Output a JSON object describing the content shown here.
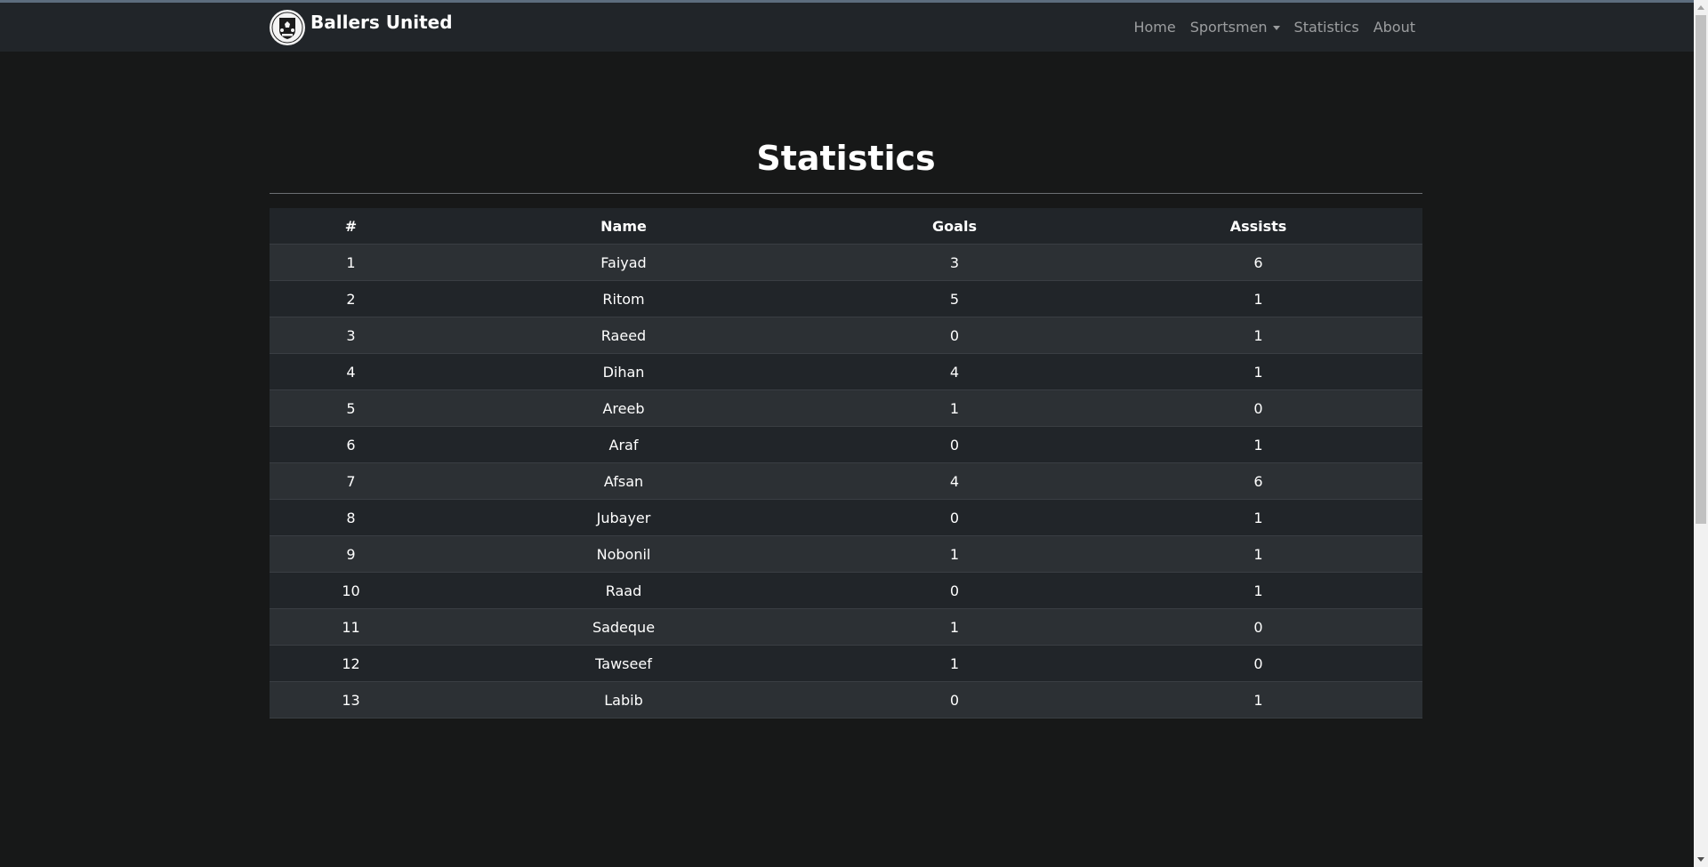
{
  "nav": {
    "brand": "Ballers United",
    "logo_icon": "club-crest-icon",
    "links": {
      "home": "Home",
      "sportsmen": "Sportsmen",
      "statistics": "Statistics",
      "about": "About"
    }
  },
  "page": {
    "title": "Statistics"
  },
  "table": {
    "headers": [
      "#",
      "Name",
      "Goals",
      "Assists"
    ],
    "rows": [
      [
        "1",
        "Faiyad",
        "3",
        "6"
      ],
      [
        "2",
        "Ritom",
        "5",
        "1"
      ],
      [
        "3",
        "Raeed",
        "0",
        "1"
      ],
      [
        "4",
        "Dihan",
        "4",
        "1"
      ],
      [
        "5",
        "Areeb",
        "1",
        "0"
      ],
      [
        "6",
        "Araf",
        "0",
        "1"
      ],
      [
        "7",
        "Afsan",
        "4",
        "6"
      ],
      [
        "8",
        "Jubayer",
        "0",
        "1"
      ],
      [
        "9",
        "Nobonil",
        "1",
        "1"
      ],
      [
        "10",
        "Raad",
        "0",
        "1"
      ],
      [
        "11",
        "Sadeque",
        "1",
        "0"
      ],
      [
        "12",
        "Tawseef",
        "1",
        "0"
      ],
      [
        "13",
        "Labib",
        "0",
        "1"
      ]
    ]
  },
  "colors": {
    "background": "#171818",
    "navbar": "#212529",
    "row_odd": "#2c3034",
    "row_even": "#212529"
  }
}
